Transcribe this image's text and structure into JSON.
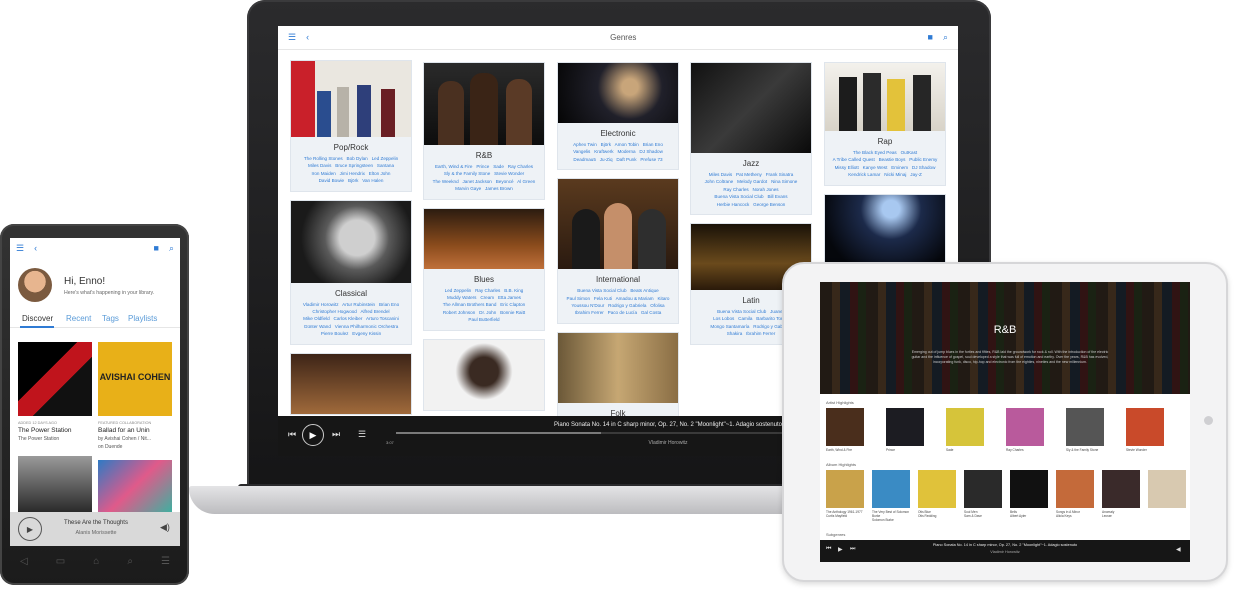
{
  "laptop": {
    "title": "Genres",
    "genres": [
      {
        "name": "Pop/Rock",
        "artists": [
          "The Rolling Stones",
          "Bob Dylan",
          "Led Zeppelin",
          "Miles Davis",
          "Bruce Springsteen",
          "Santana",
          "Iron Maiden",
          "Jimi Hendrix",
          "Elton John",
          "David Bowie",
          "Björk",
          "Van Halen"
        ]
      },
      {
        "name": "R&B",
        "artists": [
          "Earth, Wind & Fire",
          "Prince",
          "Sade",
          "Ray Charles",
          "Sly & the Family Stone",
          "Stevie Wonder",
          "The Weeknd",
          "Janet Jackson",
          "Beyoncé",
          "Al Green",
          "Marvin Gaye",
          "James Brown"
        ]
      },
      {
        "name": "Electronic",
        "artists": [
          "Aphex Twin",
          "Björk",
          "Amon Tobin",
          "Brian Eno",
          "Vangelis",
          "Kraftwerk",
          "Moderna",
          "DJ Shadow",
          "Deadmau5",
          "Ju-Ziq",
          "Daft Punk",
          "Prefuse 73"
        ]
      },
      {
        "name": "Jazz",
        "artists": [
          "Miles Davis",
          "Pat Metheny",
          "Frank Sinatra",
          "John Coltrane",
          "Melody Gardot",
          "Nina Simone",
          "Ray Charles",
          "Norah Jones",
          "Buena Vista Social Club",
          "Bill Evans",
          "Herbie Hancock",
          "George Benson"
        ]
      },
      {
        "name": "Rap",
        "artists": [
          "The Black Eyed Peas",
          "OutKast",
          "A Tribe Called Quest",
          "Beastie Boys",
          "Public Enemy",
          "Missy Elliott",
          "Kanye West",
          "Eminem",
          "DJ Shadow",
          "Kendrick Lamar",
          "Nicki Minaj",
          "Jay-Z"
        ]
      },
      {
        "name": "Classical",
        "artists": [
          "Vladimir Horowitz",
          "Artur Rubinstein",
          "Brian Eno",
          "Christopher Hogwood",
          "Alfred Brendel",
          "Mike Oldfield",
          "Carlos Kleiber",
          "Arturo Toscanini",
          "Günter Wand",
          "Vienna Philharmonic Orchestra",
          "Pierre Boulez",
          "Evgeny Kissin"
        ]
      },
      {
        "name": "Blues",
        "artists": [
          "Led Zeppelin",
          "Ray Charles",
          "B.B. King",
          "Muddy Waters",
          "Cream",
          "Etta James",
          "The Allman Brothers Band",
          "Eric Clapton",
          "Robert Johnson",
          "Dr. John",
          "Bonnie Raitt",
          "Paul Butterfield"
        ]
      },
      {
        "name": "International",
        "artists": [
          "Buena Vista Social Club",
          "Beats Antique",
          "Paul Simon",
          "Fela Kuti",
          "Amadou & Mariam",
          "Kitaro",
          "Youssou N'Dour",
          "Rodrigo y Gabriela",
          "Ofolisa",
          "Ibrahim Ferrer",
          "Paco de Lucía",
          "Gal Costa"
        ]
      },
      {
        "name": "Latin",
        "artists": [
          "Buena Vista Social Club",
          "Juanes",
          "Los Lobos",
          "Camila",
          "Barbarito Torres",
          "Mongo Santamaría",
          "Rodrigo y Gabriela",
          "Shakira",
          "Ibrahim Ferrer"
        ]
      },
      {
        "name": "Folk",
        "artists": []
      }
    ],
    "player": {
      "title": "Piano Sonata No. 14 in C sharp minor, Op. 27, No. 2 \"Moonlight\"~1. Adagio sostenuto",
      "artist": "Vladimir Horowitz",
      "time": "3:07",
      "progress": 0.38
    }
  },
  "tablet": {
    "genre_title": "R&B",
    "description": "Emerging out of jump blues in the forties and fifties, R&B laid the groundwork for rock & roll. With the introduction of the electric guitar and the influence of gospel, soul developed a style that was full of emotion and earthy. Over the years, R&B has evolved, incorporating funk, disco, hip-hop and electronic from the eighties, nineties and the new millennium.",
    "artist_section": "Artist Highlights",
    "album_section": "Album Highlights",
    "artists": [
      "Earth, Wind & Fire",
      "Prince",
      "Sade",
      "Ray Charles",
      "Sly & the Family Stone",
      "Stevie Wonder"
    ],
    "albums": [
      {
        "title": "The Anthology 1961-1977",
        "artist": "Curtis Mayfield"
      },
      {
        "title": "The Very Best of Solomon Burke",
        "artist": "Solomon Burke"
      },
      {
        "title": "Otis Blue",
        "artist": "Otis Redding"
      },
      {
        "title": "Soul Men",
        "artist": "Sam & Dave"
      },
      {
        "title": "Bells",
        "artist": "Albert Ayler"
      },
      {
        "title": "Songs in A Minor",
        "artist": "Alicia Keys"
      },
      {
        "title": "Anomaly",
        "artist": "Lecrae"
      }
    ],
    "subgenres_label": "Subgenres",
    "player_title": "Piano Sonata No. 14 in C sharp minor, Op. 27, No. 2 \"Moonlight\"~1. Adagio sostenuto",
    "player_artist": "Vladimir Horowitz"
  },
  "phone": {
    "greeting": "Hi, Enno!",
    "subtitle": "Here's what's happening in your library.",
    "tabs": [
      "Discover",
      "Recent",
      "Tags",
      "Playlists"
    ],
    "cards": [
      {
        "label": "ADDED 12 DAYS AGO",
        "title": "The Power Station",
        "sub": "The Power Station"
      },
      {
        "label": "FEATURED COLLABORATION",
        "title": "Ballad for an Unin",
        "sub": "by Avishai Cohen / Nit...",
        "sub2": "on Duende"
      }
    ],
    "cover_text": "AVISHAI COHEN",
    "player": {
      "title": "These Are the Thoughts",
      "artist": "Alanis Morissette"
    }
  },
  "icons": {
    "menu": "menu-icon",
    "back": "back-icon",
    "bookmark": "bookmark-icon",
    "search": "search-icon"
  }
}
